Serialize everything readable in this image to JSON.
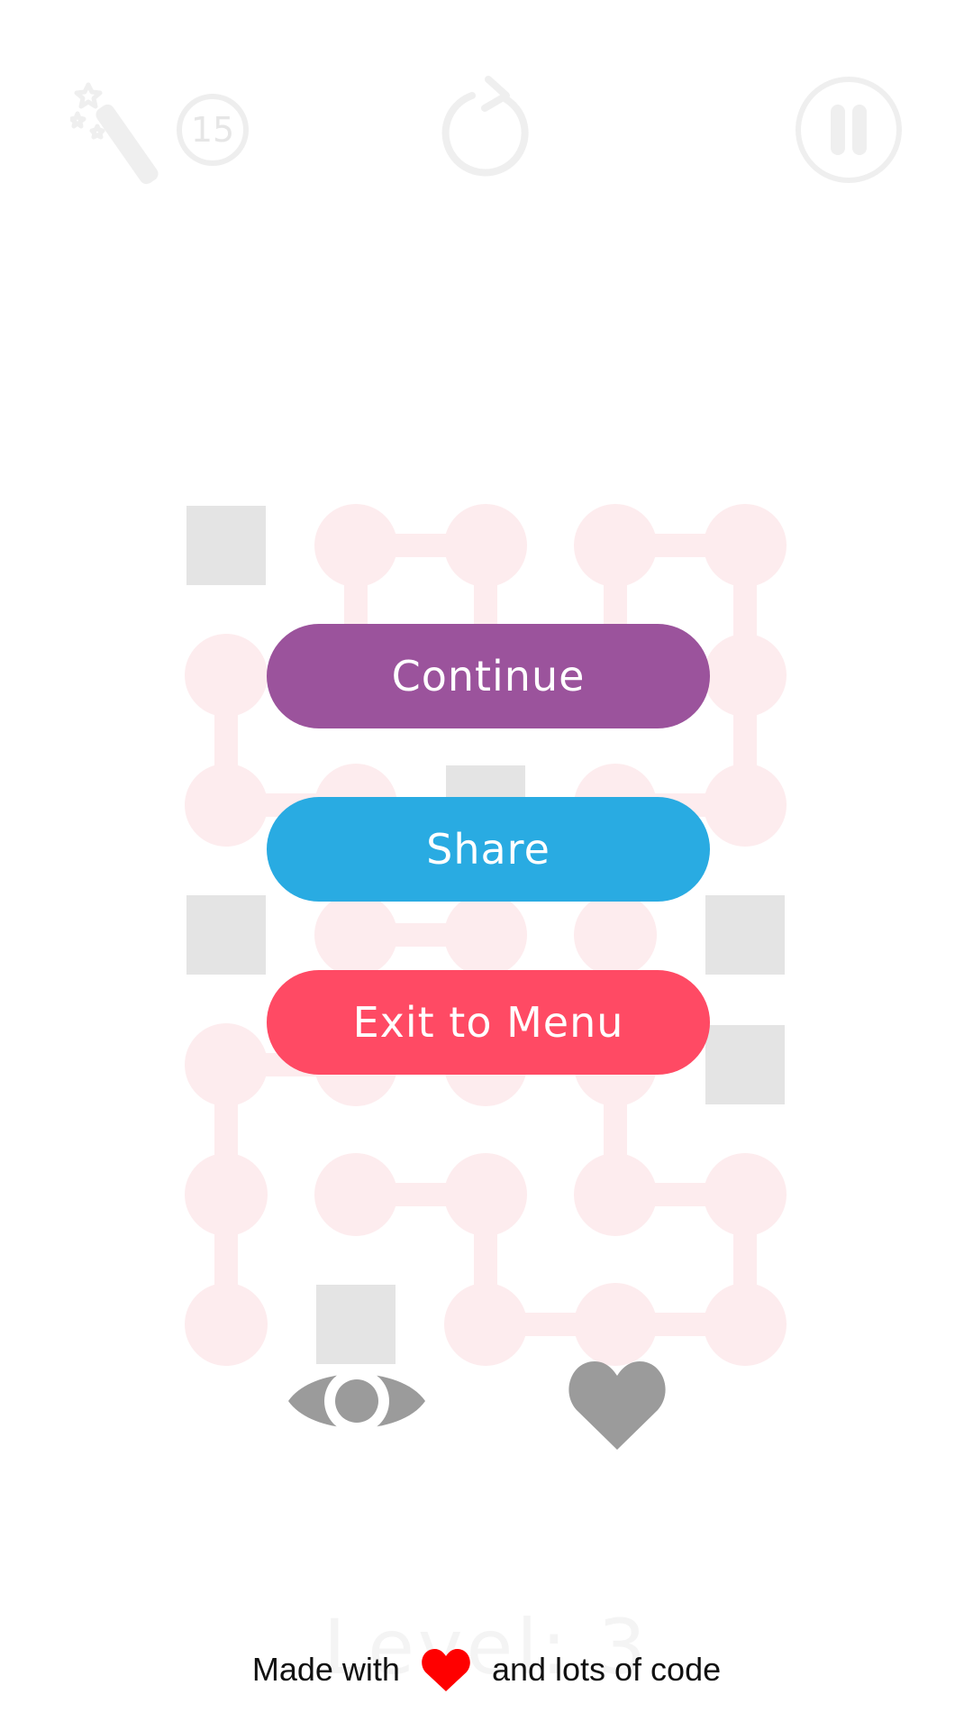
{
  "colors": {
    "background": "#ffffff",
    "continue": "#9b539c",
    "share": "#29abe2",
    "exit": "#ff4a64",
    "board_dot": "#fdecee",
    "board_block": "#e4e4e4",
    "faded_icon": "#efefef",
    "bottom_icon": "#9b9b9b",
    "footer_heart": "#ff0000"
  },
  "topbar": {
    "hint_icon": "magic-wand-icon",
    "hint_count": "15",
    "restart_icon": "restart-icon",
    "pause_icon": "pause-icon"
  },
  "pause_menu": {
    "continue_label": "Continue",
    "share_label": "Share",
    "exit_label": "Exit to Menu"
  },
  "bottom_actions": {
    "view_icon": "eye-icon",
    "like_icon": "heart-icon"
  },
  "level": {
    "label": "Level: 3"
  },
  "footer": {
    "prefix": "Made with",
    "suffix": "and lots of code",
    "heart_icon": "heart-icon"
  },
  "board": {
    "columns": 5,
    "rows": 7,
    "grid": [
      [
        "block",
        "dot",
        "dot",
        "dot",
        "dot"
      ],
      [
        "dot",
        "dot",
        "dot",
        "dot",
        "dot"
      ],
      [
        "dot",
        "dot",
        "block",
        "dot",
        "dot"
      ],
      [
        "block",
        "dot",
        "dot",
        "dot",
        "block"
      ],
      [
        "dot",
        "dot",
        "dot",
        "dot",
        "block"
      ],
      [
        "dot",
        "dot",
        "dot",
        "dot",
        "dot"
      ],
      [
        "dot",
        "block",
        "dot",
        "dot",
        "dot"
      ]
    ],
    "links": [
      [
        0,
        1,
        0,
        2
      ],
      [
        0,
        1,
        1,
        1
      ],
      [
        0,
        2,
        1,
        2
      ],
      [
        0,
        3,
        0,
        4
      ],
      [
        0,
        3,
        1,
        3
      ],
      [
        0,
        4,
        1,
        4
      ],
      [
        1,
        0,
        2,
        0
      ],
      [
        2,
        0,
        2,
        1
      ],
      [
        1,
        4,
        2,
        4
      ],
      [
        2,
        3,
        2,
        4
      ],
      [
        3,
        1,
        3,
        2
      ],
      [
        4,
        0,
        4,
        1
      ],
      [
        4,
        0,
        5,
        0
      ],
      [
        5,
        0,
        6,
        0
      ],
      [
        4,
        3,
        5,
        3
      ],
      [
        5,
        1,
        5,
        2
      ],
      [
        5,
        2,
        6,
        2
      ],
      [
        5,
        3,
        5,
        4
      ],
      [
        5,
        4,
        6,
        4
      ],
      [
        6,
        2,
        6,
        3
      ],
      [
        6,
        3,
        6,
        4
      ]
    ]
  }
}
